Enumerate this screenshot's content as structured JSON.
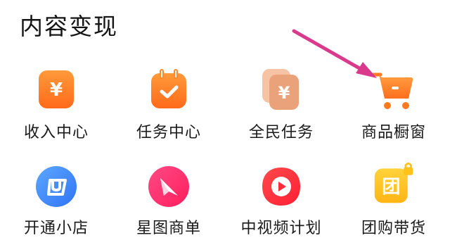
{
  "section": {
    "title": "内容变现"
  },
  "items": [
    {
      "label": "收入中心",
      "icon": "income-yen-icon"
    },
    {
      "label": "任务中心",
      "icon": "task-calendar-icon"
    },
    {
      "label": "全民任务",
      "icon": "cards-yen-icon"
    },
    {
      "label": "商品橱窗",
      "icon": "shopping-cart-icon"
    },
    {
      "label": "开通小店",
      "icon": "store-shopping-bag-icon"
    },
    {
      "label": "星图商单",
      "icon": "star-map-icon"
    },
    {
      "label": "中视频计划",
      "icon": "video-play-icon"
    },
    {
      "label": "团购带货",
      "icon": "group-buy-lock-icon"
    }
  ],
  "colors": {
    "orange": "#FF7A1E",
    "orange_light": "#FFA044",
    "peach": "#F3B08A",
    "blue": "#3D8BFF",
    "pink": "#FF2D6F",
    "red": "#FF2B3A",
    "yellow": "#FFC21B",
    "annotation_arrow": "#D93A8B"
  }
}
